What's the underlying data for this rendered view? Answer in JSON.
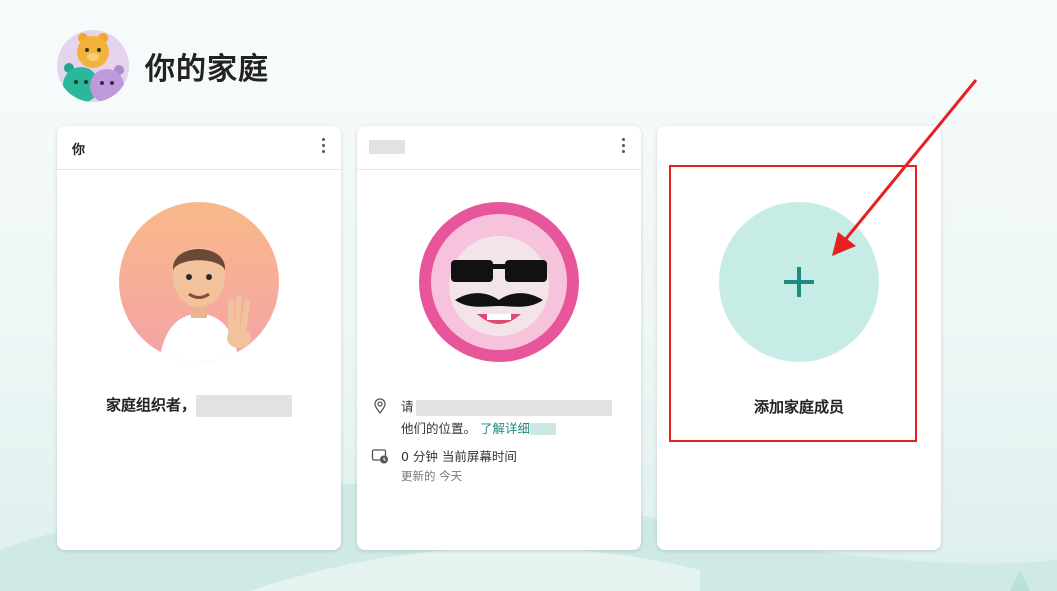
{
  "page": {
    "title": "你的家庭"
  },
  "cards": [
    {
      "name": "你",
      "role_label": "家庭组织者，"
    },
    {
      "location_text": "请",
      "location_text_line2": "他们的位置。",
      "location_link": "了解详细",
      "screen_time_value": "0 分钟 当前屏幕时间",
      "screen_time_updated": "更新的 今天"
    },
    {
      "add_label": "添加家庭成员"
    }
  ],
  "colors": {
    "accent": "#1f8a80",
    "add_circle": "#c7ebe5",
    "highlight": "#e62020"
  }
}
